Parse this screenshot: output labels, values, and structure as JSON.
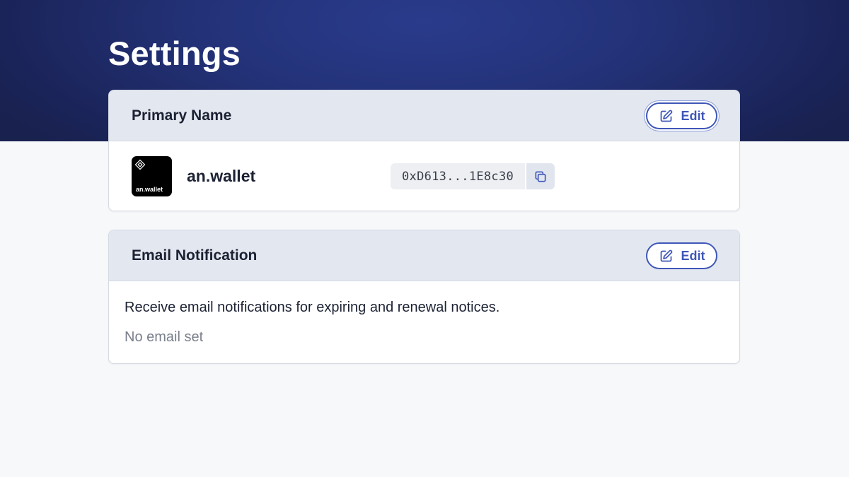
{
  "page": {
    "title": "Settings"
  },
  "colors": {
    "hero_background": "#233278",
    "accent": "#3f57b8",
    "card_header": "#e3e7f0",
    "page_background": "#f7f8fa"
  },
  "primary_name": {
    "title": "Primary Name",
    "edit_label": "Edit",
    "edit_icon": "edit-icon",
    "avatar_text": "an.wallet",
    "avatar_icon": "wallet-logo-icon",
    "name": "an.wallet",
    "address": "0xD613...1E8c30",
    "copy_icon": "copy-icon"
  },
  "email_notification": {
    "title": "Email Notification",
    "edit_label": "Edit",
    "edit_icon": "edit-icon",
    "description": "Receive email notifications for expiring and renewal notices.",
    "status": "No email set"
  }
}
